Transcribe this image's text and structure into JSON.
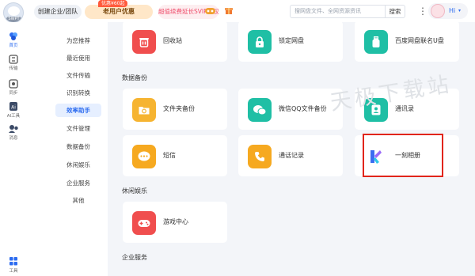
{
  "header": {
    "avatar_tag": "SWPT",
    "create_team_label": "创建企业/团队",
    "promo_badge": "优惠¥60起",
    "vip_label": "老用户优惠",
    "svip_label": "超值续费延长SVIP特权",
    "search_placeholder": "搜网盘文件、全网资源资讯",
    "search_button": "搜索",
    "more_icon": "⋮",
    "greeting": "Hi",
    "dropdown_icon": "▾"
  },
  "rail": {
    "items": [
      {
        "label": "首页",
        "icon": "flower-icon"
      },
      {
        "label": "传输",
        "icon": "transfer-icon"
      },
      {
        "label": "同步",
        "icon": "sync-icon"
      },
      {
        "label": "AI工具",
        "icon": "ai-icon"
      },
      {
        "label": "消息",
        "icon": "message-icon"
      }
    ],
    "bottom_label": "工具"
  },
  "sidebar": {
    "items": [
      {
        "label": "为您推荐"
      },
      {
        "label": "最近使用"
      },
      {
        "label": "文件传输"
      },
      {
        "label": "识别转换"
      },
      {
        "label": "效率助手"
      },
      {
        "label": "文件管理"
      },
      {
        "label": "数据备份"
      },
      {
        "label": "休闲娱乐"
      },
      {
        "label": "企业服务"
      },
      {
        "label": "其他"
      }
    ],
    "selected": "效率助手"
  },
  "main": {
    "top_row": [
      {
        "label": "回收站",
        "icon": "trash-icon",
        "color": "#f04e4e"
      },
      {
        "label": "锁定网盘",
        "icon": "lock-icon",
        "color": "#1fbfa5"
      },
      {
        "label": "百度网盘联名U盘",
        "icon": "usb-icon",
        "color": "#1fbfa5"
      }
    ],
    "backup_section": "数据备份",
    "backup_row1": [
      {
        "label": "文件夹备份",
        "icon": "folder-sync-icon",
        "color": "#f6b431"
      },
      {
        "label": "微信QQ文件备份",
        "icon": "chat-bubbles-icon",
        "color": "#1fbfa5"
      },
      {
        "label": "通讯录",
        "icon": "contacts-icon",
        "color": "#1fbfa5"
      }
    ],
    "backup_row2": [
      {
        "label": "短信",
        "icon": "sms-icon",
        "color": "#f6a920"
      },
      {
        "label": "通话记录",
        "icon": "phone-icon",
        "color": "#f6a920"
      },
      {
        "label": "一刻相册",
        "icon": "yike-album-icon",
        "color": "#3a6df0"
      }
    ],
    "leisure_section": "休闲娱乐",
    "leisure_row": [
      {
        "label": "游戏中心",
        "icon": "gamepad-icon",
        "color": "#f04e4e"
      }
    ],
    "enterprise_section": "企业服务"
  },
  "watermark": "天极下载站"
}
